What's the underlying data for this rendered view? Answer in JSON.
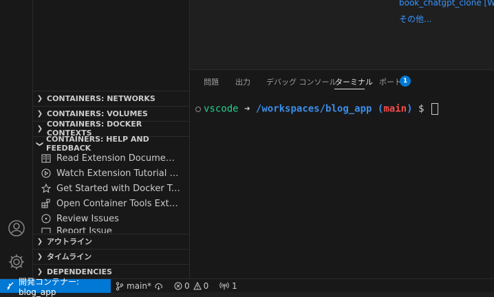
{
  "editor": {
    "links": [
      "book_chatgpt_clone [WS",
      "その他..."
    ]
  },
  "sidebar": {
    "sections_top": [
      {
        "label": "CONTAINERS: NETWORKS",
        "expanded": false
      },
      {
        "label": "CONTAINERS: VOLUMES",
        "expanded": false
      },
      {
        "label": "CONTAINERS: DOCKER CONTEXTS",
        "expanded": false
      },
      {
        "label": "CONTAINERS: HELP AND FEEDBACK",
        "expanded": true
      }
    ],
    "help_items": [
      {
        "label": "Read Extension Documentation",
        "icon": "book-icon"
      },
      {
        "label": "Watch Extension Tutorial Videos",
        "icon": "play-circle-icon"
      },
      {
        "label": "Get Started with Docker Tutorial",
        "icon": "star-icon"
      },
      {
        "label": "Open Container Tools Extension",
        "icon": "extensions-icon"
      },
      {
        "label": "Review Issues",
        "icon": "issues-icon"
      },
      {
        "label": "Report Issue",
        "icon": "comment-icon"
      }
    ],
    "sections_bottom": [
      {
        "label": "アウトライン",
        "expanded": false
      },
      {
        "label": "タイムライン",
        "expanded": false
      },
      {
        "label": "DEPENDENCIES",
        "expanded": false
      }
    ]
  },
  "panel": {
    "tabs": [
      "問題",
      "出力",
      "デバッグ コンソール",
      "ターミナル",
      "ポート"
    ],
    "active_tab": "ターミナル",
    "ports_badge": "1"
  },
  "terminal": {
    "user": "vscode",
    "arrow": "➜",
    "path": "/workspaces/blog_app",
    "branch_open": "(",
    "branch": "main",
    "branch_close": ")",
    "prompt": "$"
  },
  "statusbar": {
    "remote": "開発コンテナー: blog_app",
    "branch": "main*",
    "errors": "0",
    "warnings": "0",
    "ports": "1"
  },
  "colors": {
    "accent": "#0078d4",
    "terminal_green": "#23d18b",
    "terminal_blue": "#3b8eea",
    "terminal_red": "#f14c4c",
    "link": "#3794ff"
  }
}
